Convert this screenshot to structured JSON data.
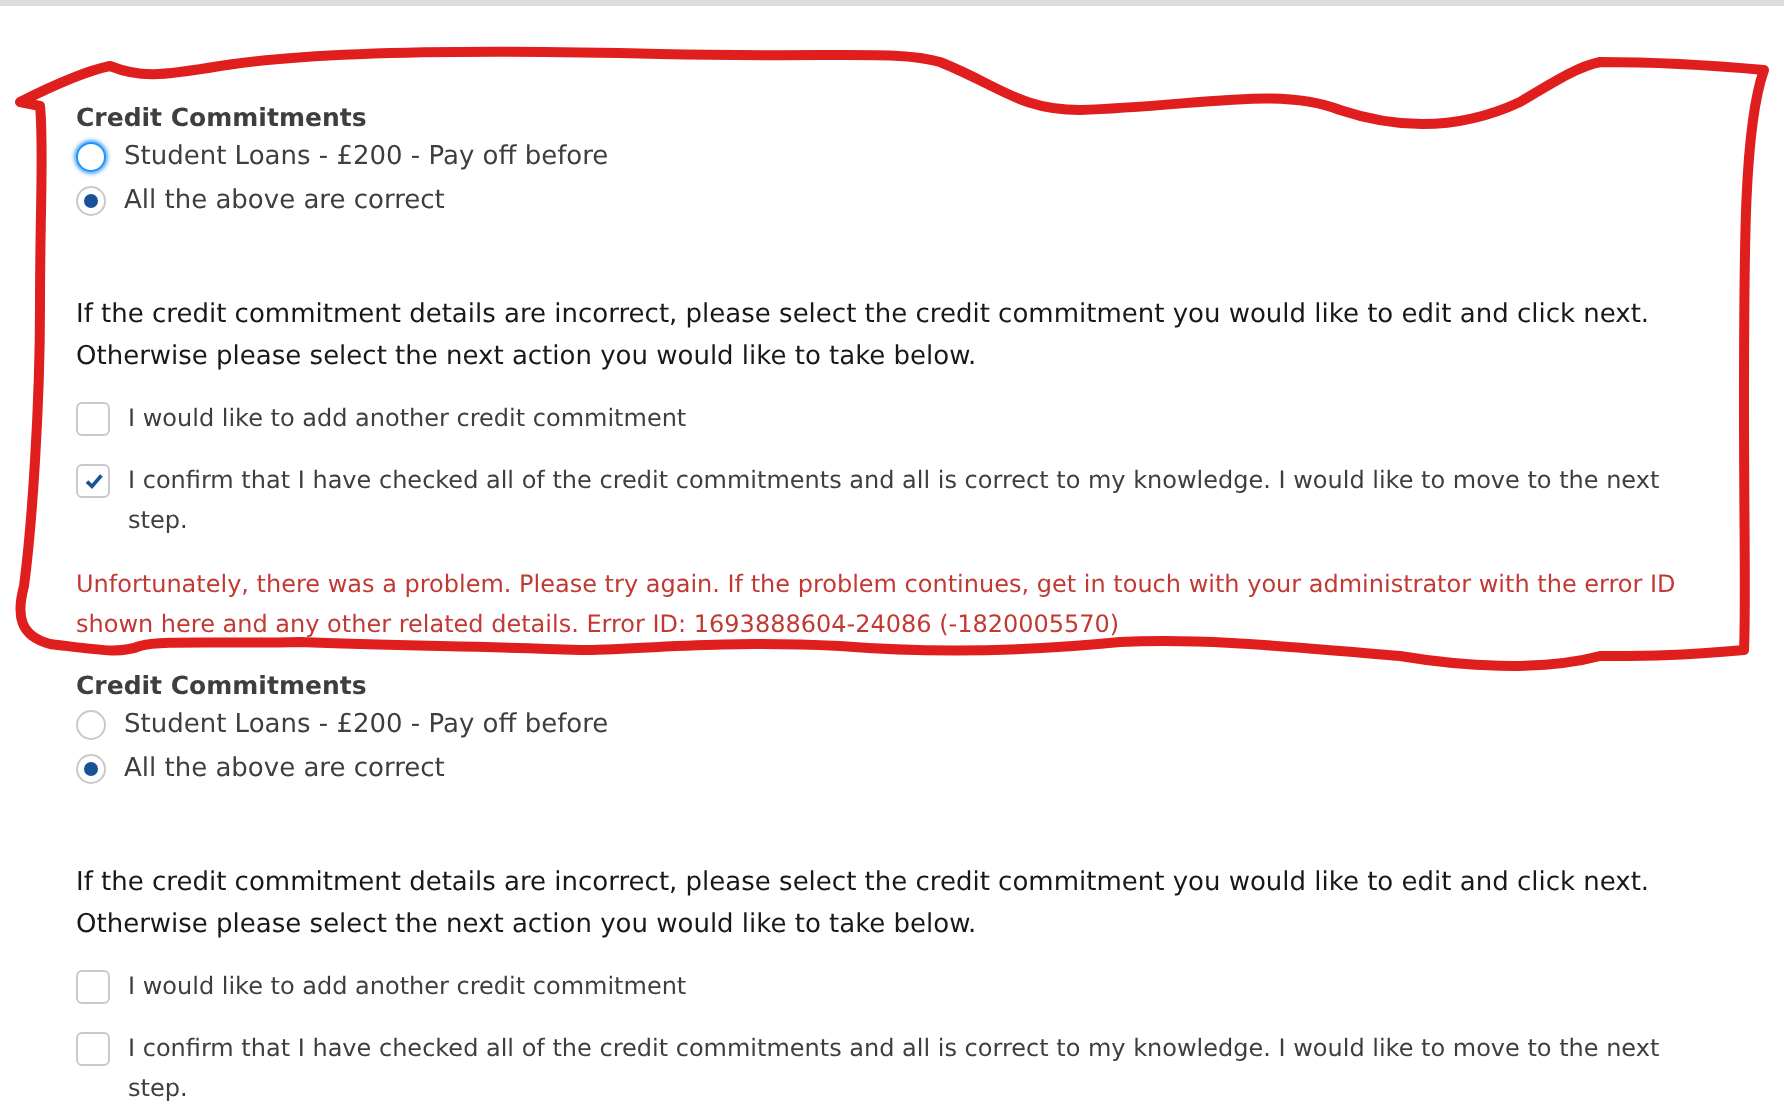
{
  "sections": [
    {
      "title": "Credit Commitments",
      "options": [
        {
          "label": "Student Loans - £200 - Pay off before",
          "selected": false,
          "focused": true
        },
        {
          "label": "All the above are correct",
          "selected": true,
          "focused": false
        }
      ],
      "instructions": [
        "If the credit commitment details are incorrect, please select the credit commitment you would like to edit and click next.",
        "Otherwise please select the next action you would like to take below."
      ],
      "checkboxes": [
        {
          "label": "I would like to add another credit commitment",
          "checked": false
        },
        {
          "label": "I confirm that I have checked all of the credit commitments and all is correct to my knowledge. I would like to move to the next step.",
          "checked": true
        }
      ],
      "error": "Unfortunately, there was a problem. Please try again. If the problem continues, get in touch with your administrator with the error ID shown here and any other related details. Error ID: 1693888604-24086 (-1820005570)"
    },
    {
      "title": "Credit Commitments",
      "options": [
        {
          "label": "Student Loans - £200 - Pay off before",
          "selected": false,
          "focused": false
        },
        {
          "label": "All the above are correct",
          "selected": true,
          "focused": false
        }
      ],
      "instructions": [
        "If the credit commitment details are incorrect, please select the credit commitment you would like to edit and click next.",
        "Otherwise please select the next action you would like to take below."
      ],
      "checkboxes": [
        {
          "label": "I would like to add another credit commitment",
          "checked": false
        },
        {
          "label": "I confirm that I have checked all of the credit commitments and all is correct to my knowledge. I would like to move to the next step.",
          "checked": false
        }
      ]
    }
  ],
  "annotation": {
    "kind": "outline",
    "color": "#e01e1e"
  }
}
